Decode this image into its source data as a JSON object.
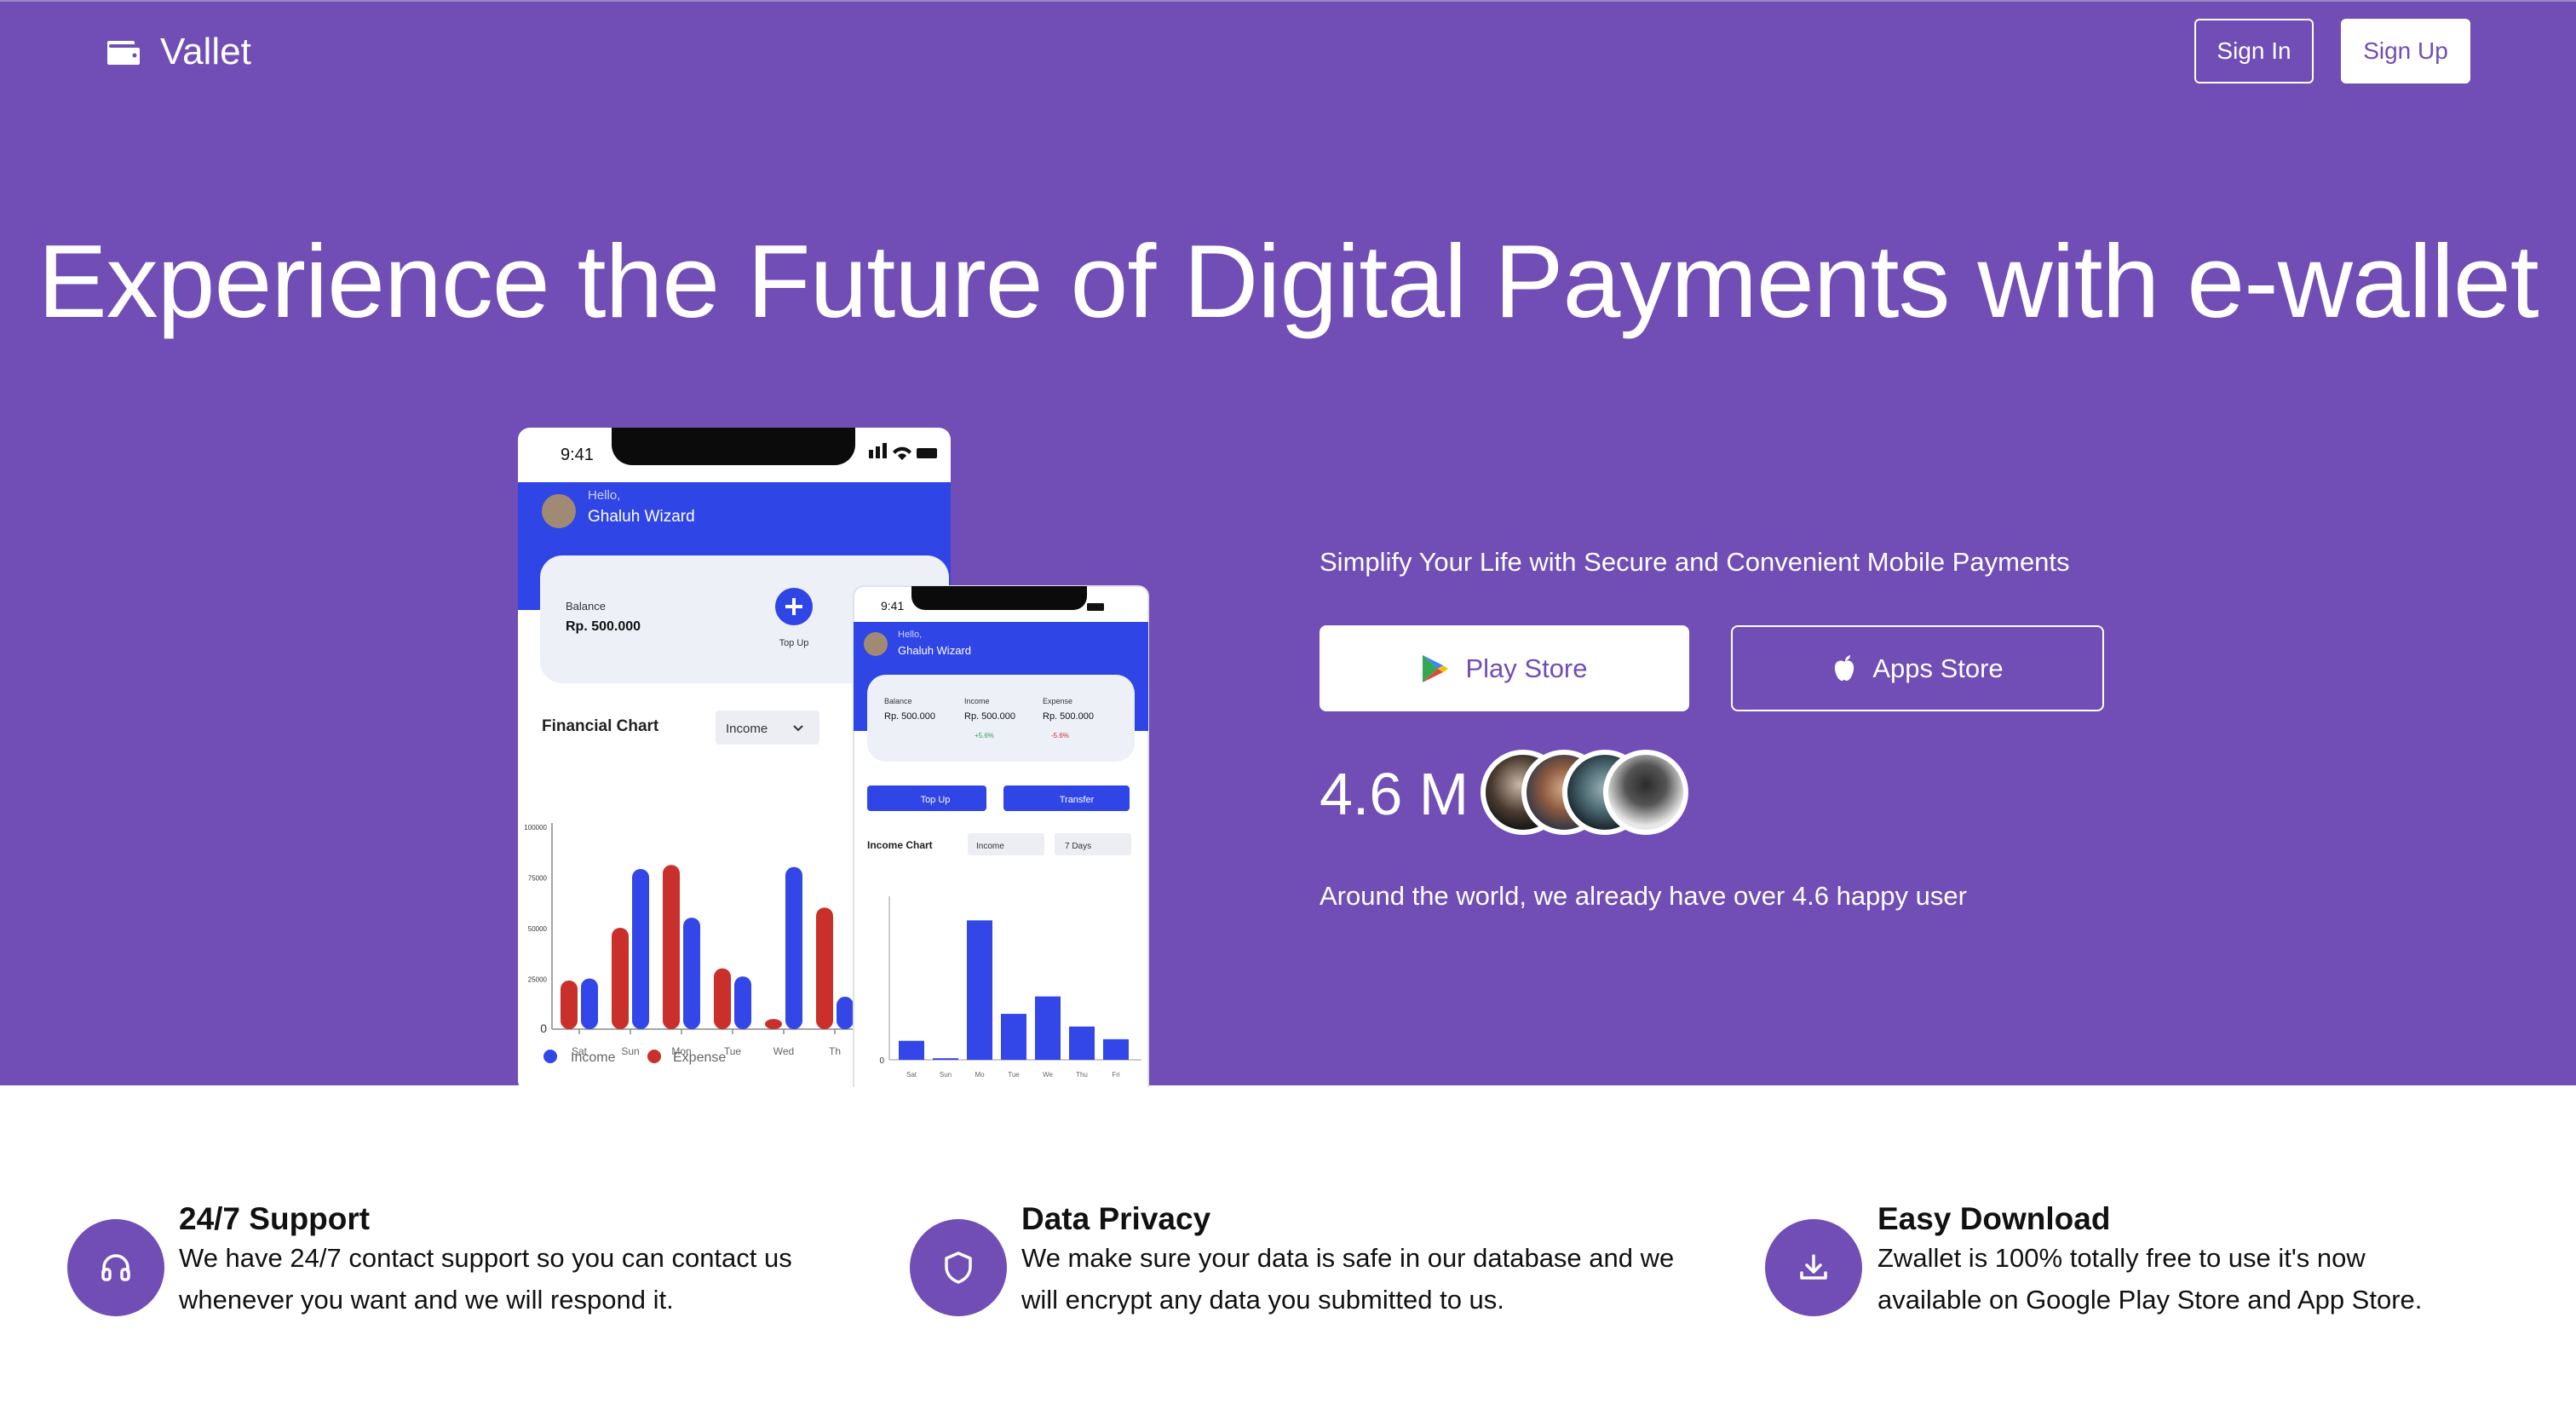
{
  "brand": {
    "name": "Vallet",
    "icon": "wallet-icon"
  },
  "nav": {
    "sign_in": "Sign In",
    "sign_up": "Sign Up"
  },
  "hero": {
    "headline": "Experience the Future of Digital Payments with e-wallet",
    "tagline": "Simplify Your Life with Secure and Convenient Mobile Payments",
    "play_store": "Play Store",
    "apps_store": "Apps Store",
    "users_count": "4.6 M",
    "happy_users": "Around the world, we already have over 4.6 happy user"
  },
  "mockup_large": {
    "time": "9:41",
    "greeting": "Hello,",
    "user": "Ghaluh Wizard",
    "balance_label": "Balance",
    "balance_value": "Rp. 500.000",
    "topup_label": "Top Up",
    "chart_title": "Financial Chart",
    "dropdown": "Income",
    "y_ticks": [
      "100000",
      "75000",
      "50000",
      "25000",
      "0"
    ],
    "x_ticks": [
      "Sat",
      "Sun",
      "Mon",
      "Tue",
      "Wed",
      "Th"
    ],
    "legend_income": "Income",
    "legend_expense": "Expense",
    "chart_data": {
      "type": "bar",
      "categories": [
        "Sat",
        "Sun",
        "Mon",
        "Tue",
        "Wed",
        "Th"
      ],
      "series": [
        {
          "name": "Income",
          "values": [
            25000,
            79000,
            55000,
            26000,
            80000,
            16000
          ]
        },
        {
          "name": "Expense",
          "values": [
            24000,
            50000,
            81000,
            30000,
            5000,
            60000
          ]
        }
      ],
      "ylim": [
        0,
        100000
      ]
    }
  },
  "mockup_small": {
    "time": "9:41",
    "greeting": "Hello,",
    "user": "Ghaluh Wizard",
    "balance_label": "Balance",
    "balance_value": "Rp. 500.000",
    "income_label": "Income",
    "income_value": "Rp. 500.000",
    "expense_label": "Expense",
    "expense_value": "Rp. 500.000",
    "income_change": "+5.6%",
    "expense_change": "-5.6%",
    "topup": "Top Up",
    "transfer": "Transfer",
    "chart_title": "Income Chart",
    "dropdown1": "Income",
    "dropdown2": "7 Days",
    "x_ticks": [
      "Sat",
      "Sun",
      "Mo",
      "Tue",
      "We",
      "Thu",
      "Fri"
    ],
    "chart_data": {
      "type": "bar",
      "categories": [
        "Sat",
        "Sun",
        "Mo",
        "Tue",
        "We",
        "Thu",
        "Fri"
      ],
      "series": [
        {
          "name": "Income",
          "values": [
            12,
            1,
            88,
            29,
            40,
            21,
            13
          ]
        }
      ],
      "ylim": [
        0,
        100
      ]
    }
  },
  "features": [
    {
      "title": "24/7 Support",
      "text1": "We have 24/7 contact support so you can contact us",
      "text2": "whenever you want and we will respond it.",
      "icon": "headphones-icon"
    },
    {
      "title": "Data Privacy",
      "text1": "We make sure your data is safe in our database and we",
      "text2": "will encrypt any data you submitted to us.",
      "icon": "shield-icon"
    },
    {
      "title": "Easy Download",
      "text1": "Zwallet is 100% totally free to use it's now",
      "text2": "available on Google Play Store and App Store.",
      "icon": "download-icon"
    }
  ],
  "colors": {
    "hero": "#714db6",
    "income": "#3347e8",
    "expense": "#c9302c"
  }
}
